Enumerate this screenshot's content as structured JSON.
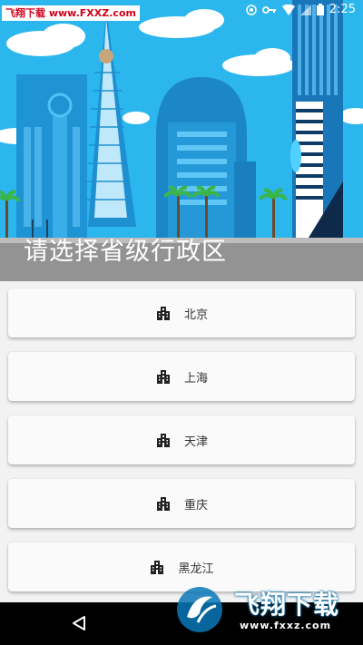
{
  "status_bar": {
    "watermark": "飞翔下载 www.FXXZ.com",
    "time": "2:25"
  },
  "header": {
    "title": "请选择省级行政区"
  },
  "provinces": [
    {
      "label": "北京"
    },
    {
      "label": "上海"
    },
    {
      "label": "天津"
    },
    {
      "label": "重庆"
    },
    {
      "label": "黑龙江"
    }
  ],
  "watermark": {
    "title": "飞翔下载",
    "url": "www.fxxz.com"
  },
  "icons": {
    "province": "building-icon",
    "nav_back": "back-triangle-icon"
  }
}
